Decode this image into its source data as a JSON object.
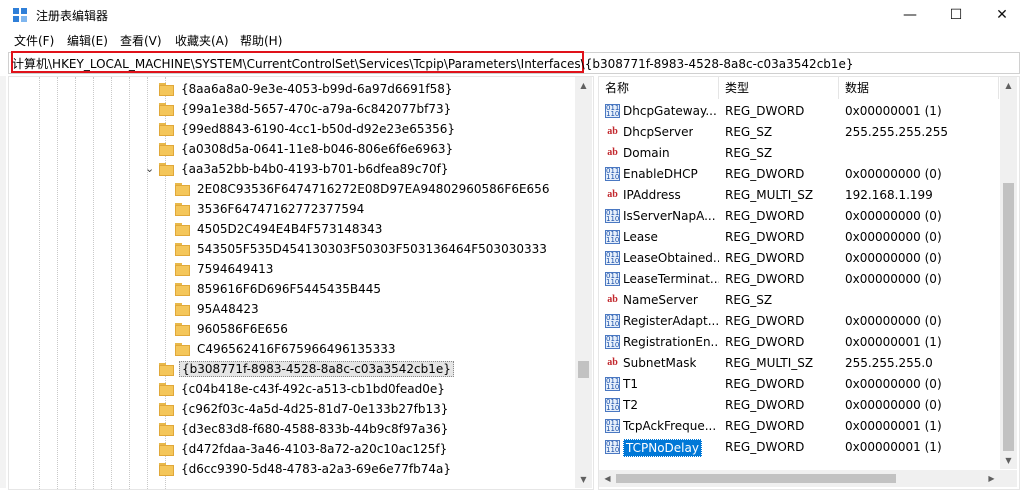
{
  "window": {
    "title": "注册表编辑器"
  },
  "window_controls": {
    "minimize": "—",
    "maximize": "☐",
    "close": "✕"
  },
  "menu": [
    "文件(F)",
    "编辑(E)",
    "查看(V)",
    "收藏夹(A)",
    "帮助(H)"
  ],
  "address": {
    "highlighted": "计算机\\HKEY_LOCAL_MACHINE\\SYSTEM\\CurrentControlSet\\Services\\Tcpip\\Parameters\\Interfaces\\",
    "rest": "{b308771f-8983-4528-8a8c-c03a3542cb1e}",
    "highlight_color": "#e0121a"
  },
  "tree": {
    "items": [
      {
        "label": "{8aa6a8a0-9e3e-4053-b99d-6a97d6691f58}",
        "level": 1
      },
      {
        "label": "{99a1e38d-5657-470c-a79a-6c842077bf73}",
        "level": 1
      },
      {
        "label": "{99ed8843-6190-4cc1-b50d-d92e23e65356}",
        "level": 1
      },
      {
        "label": "{a0308d5a-0641-11e8-b046-806e6f6e6963}",
        "level": 1
      },
      {
        "label": "{aa3a52bb-b4b0-4193-b701-b6dfea89c70f}",
        "level": 1,
        "expanded": true
      },
      {
        "label": "2E08C93536F6474716272E08D97EA94802960586F6E656",
        "level": 2
      },
      {
        "label": "3536F64747162772377594",
        "level": 2
      },
      {
        "label": "4505D2C494E4B4F573148343",
        "level": 2
      },
      {
        "label": "543505F535D454130303F50303F503136464F503030333",
        "level": 2
      },
      {
        "label": "7594649413",
        "level": 2
      },
      {
        "label": "859616F6D696F5445435B445",
        "level": 2
      },
      {
        "label": "95A48423",
        "level": 2
      },
      {
        "label": "960586F6E656",
        "level": 2
      },
      {
        "label": "C496562416F675966496135333",
        "level": 2
      },
      {
        "label": "{b308771f-8983-4528-8a8c-c03a3542cb1e}",
        "level": 1,
        "selected": true
      },
      {
        "label": "{c04b418e-c43f-492c-a513-cb1bd0fead0e}",
        "level": 1
      },
      {
        "label": "{c962f03c-4a5d-4d25-81d7-0e133b27fb13}",
        "level": 1
      },
      {
        "label": "{d3ec83d8-f680-4588-833b-44b9c8f97a36}",
        "level": 1
      },
      {
        "label": "{d472fdaa-3a46-4103-8a72-a20c10ac125f}",
        "level": 1
      },
      {
        "label": "{d6cc9390-5d48-4783-a2a3-69e6e77fb74a}",
        "level": 1
      }
    ]
  },
  "values": {
    "headers": [
      "名称",
      "类型",
      "数据"
    ],
    "rows": [
      {
        "name": "DhcpGateway...",
        "type": "REG_DWORD",
        "data": "0x00000001 (1)",
        "icon": "binary-value-icon"
      },
      {
        "name": "DhcpServer",
        "type": "REG_SZ",
        "data": "255.255.255.255",
        "icon": "string-value-icon"
      },
      {
        "name": "Domain",
        "type": "REG_SZ",
        "data": "",
        "icon": "string-value-icon"
      },
      {
        "name": "EnableDHCP",
        "type": "REG_DWORD",
        "data": "0x00000000 (0)",
        "icon": "binary-value-icon"
      },
      {
        "name": "IPAddress",
        "type": "REG_MULTI_SZ",
        "data": "192.168.1.199",
        "icon": "string-value-icon"
      },
      {
        "name": "IsServerNapA...",
        "type": "REG_DWORD",
        "data": "0x00000000 (0)",
        "icon": "binary-value-icon"
      },
      {
        "name": "Lease",
        "type": "REG_DWORD",
        "data": "0x00000000 (0)",
        "icon": "binary-value-icon"
      },
      {
        "name": "LeaseObtained...",
        "type": "REG_DWORD",
        "data": "0x00000000 (0)",
        "icon": "binary-value-icon"
      },
      {
        "name": "LeaseTerminat...",
        "type": "REG_DWORD",
        "data": "0x00000000 (0)",
        "icon": "binary-value-icon"
      },
      {
        "name": "NameServer",
        "type": "REG_SZ",
        "data": "",
        "icon": "string-value-icon"
      },
      {
        "name": "RegisterAdapt...",
        "type": "REG_DWORD",
        "data": "0x00000000 (0)",
        "icon": "binary-value-icon"
      },
      {
        "name": "RegistrationEn...",
        "type": "REG_DWORD",
        "data": "0x00000001 (1)",
        "icon": "binary-value-icon"
      },
      {
        "name": "SubnetMask",
        "type": "REG_MULTI_SZ",
        "data": "255.255.255.0",
        "icon": "string-value-icon"
      },
      {
        "name": "T1",
        "type": "REG_DWORD",
        "data": "0x00000000 (0)",
        "icon": "binary-value-icon"
      },
      {
        "name": "T2",
        "type": "REG_DWORD",
        "data": "0x00000000 (0)",
        "icon": "binary-value-icon"
      },
      {
        "name": "TcpAckFreque...",
        "type": "REG_DWORD",
        "data": "0x00000001 (1)",
        "icon": "binary-value-icon"
      },
      {
        "name": "TCPNoDelay",
        "type": "REG_DWORD",
        "data": "0x00000001 (1)",
        "icon": "binary-value-icon",
        "selected": true
      }
    ]
  },
  "colors": {
    "selection": "#0078d7",
    "folder": "#f4c65a",
    "string_icon": "#c2272d"
  }
}
